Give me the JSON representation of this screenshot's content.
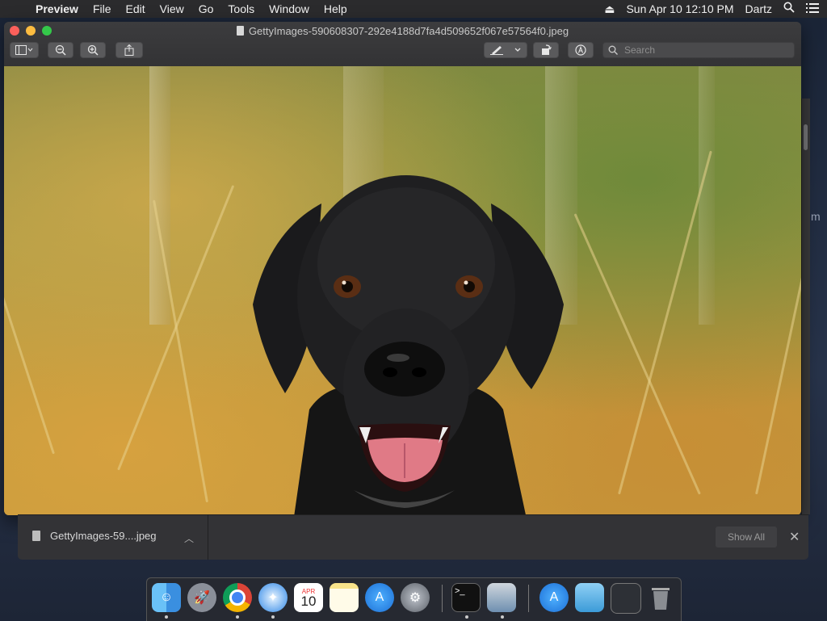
{
  "menubar": {
    "apple_glyph": "",
    "app_name": "Preview",
    "menus": [
      "File",
      "Edit",
      "View",
      "Go",
      "Tools",
      "Window",
      "Help"
    ],
    "clock": "Sun Apr 10  12:10 PM",
    "user": "Dartz"
  },
  "window": {
    "title": "GettyImages-590608307-292e4188d7fa4d509652f067e57564f0.jpeg",
    "search_placeholder": "Search"
  },
  "downloads": {
    "file_name": "GettyImages-59....jpeg",
    "show_all_label": "Show All"
  },
  "dock": {
    "calendar_month": "APR",
    "calendar_day": "10"
  },
  "side_letter": "m"
}
